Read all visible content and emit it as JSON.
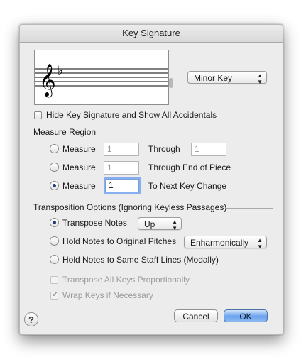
{
  "window": {
    "title": "Key Signature"
  },
  "preview": {
    "clef_glyph": "𝄞",
    "accidental_glyph": "♭"
  },
  "mode_popup": {
    "value": "Minor Key"
  },
  "hide_key_sig": {
    "label": "Hide Key Signature and Show All Accidentals",
    "checked": false
  },
  "measure_region": {
    "title": "Measure Region",
    "rows": [
      {
        "radio_label": "Measure",
        "value": "1",
        "through_label": "Through",
        "through_value": "1",
        "selected": false
      },
      {
        "radio_label": "Measure",
        "value": "1",
        "through_label": "Through End of Piece",
        "selected": false
      },
      {
        "radio_label": "Measure",
        "value": "1",
        "through_label": "To Next Key Change",
        "selected": true
      }
    ]
  },
  "transposition": {
    "title": "Transposition Options (Ignoring Keyless Passages)",
    "transpose_notes": {
      "label": "Transpose Notes",
      "direction": "Up",
      "selected": true
    },
    "hold_original": {
      "label": "Hold Notes to Original Pitches",
      "method": "Enharmonically",
      "selected": false
    },
    "hold_staff": {
      "label": "Hold Notes to Same Staff Lines (Modally)",
      "selected": false
    },
    "transpose_all": {
      "label": "Transpose All Keys Proportionally",
      "checked": false,
      "enabled": false
    },
    "wrap_keys": {
      "label": "Wrap Keys if Necessary",
      "checked": true,
      "enabled": false
    }
  },
  "buttons": {
    "help": "?",
    "cancel": "Cancel",
    "ok": "OK"
  },
  "colors": {
    "dialog_bg": "#ececec",
    "default_button": "#6aa3ec",
    "focus_ring": "#86aef0"
  }
}
